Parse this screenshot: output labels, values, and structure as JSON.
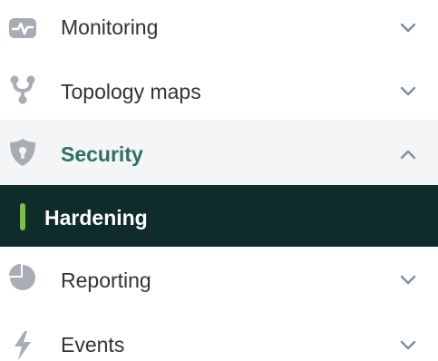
{
  "menu": {
    "items": [
      {
        "label": "Monitoring",
        "icon": "monitoring-icon",
        "expanded": false
      },
      {
        "label": "Topology maps",
        "icon": "topology-icon",
        "expanded": false
      },
      {
        "label": "Security",
        "icon": "shield-icon",
        "expanded": true,
        "children": [
          {
            "label": "Hardening",
            "active": true
          }
        ]
      },
      {
        "label": "Reporting",
        "icon": "pie-chart-icon",
        "expanded": false
      },
      {
        "label": "Events",
        "icon": "lightning-icon",
        "expanded": false
      }
    ]
  },
  "colors": {
    "icon": "#a8adb3",
    "chevron": "#7d8f9e",
    "text": "#333333",
    "active_section_text": "#2f6e63",
    "active_section_bg": "#f4f5f7",
    "selected_bg": "#0f2b2a",
    "selected_indicator": "#7ac143",
    "selected_text": "#ffffff"
  }
}
